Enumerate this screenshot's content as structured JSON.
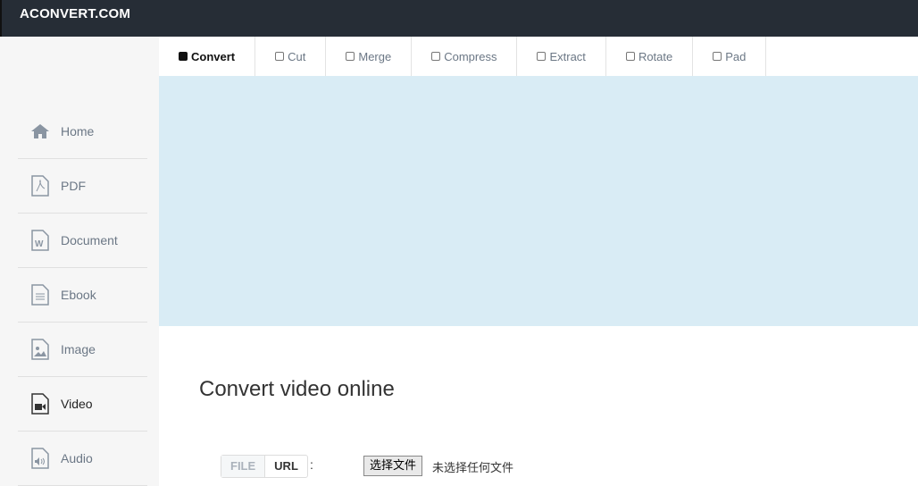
{
  "header": {
    "logo": "ACONVERT.COM"
  },
  "sidebar": {
    "items": [
      {
        "label": "Home",
        "icon": "home-icon"
      },
      {
        "label": "PDF",
        "icon": "pdf-icon"
      },
      {
        "label": "Document",
        "icon": "document-icon"
      },
      {
        "label": "Ebook",
        "icon": "ebook-icon"
      },
      {
        "label": "Image",
        "icon": "image-icon"
      },
      {
        "label": "Video",
        "icon": "video-icon"
      },
      {
        "label": "Audio",
        "icon": "audio-icon"
      }
    ],
    "active": "Video"
  },
  "tabs": [
    "Convert",
    "Cut",
    "Merge",
    "Compress",
    "Extract",
    "Rotate",
    "Pad"
  ],
  "main": {
    "title": "Convert video online",
    "file_label": "FILE",
    "url_label": "URL",
    "colon": ":",
    "choose_button": "选择文件",
    "no_file": "未选择任何文件"
  }
}
